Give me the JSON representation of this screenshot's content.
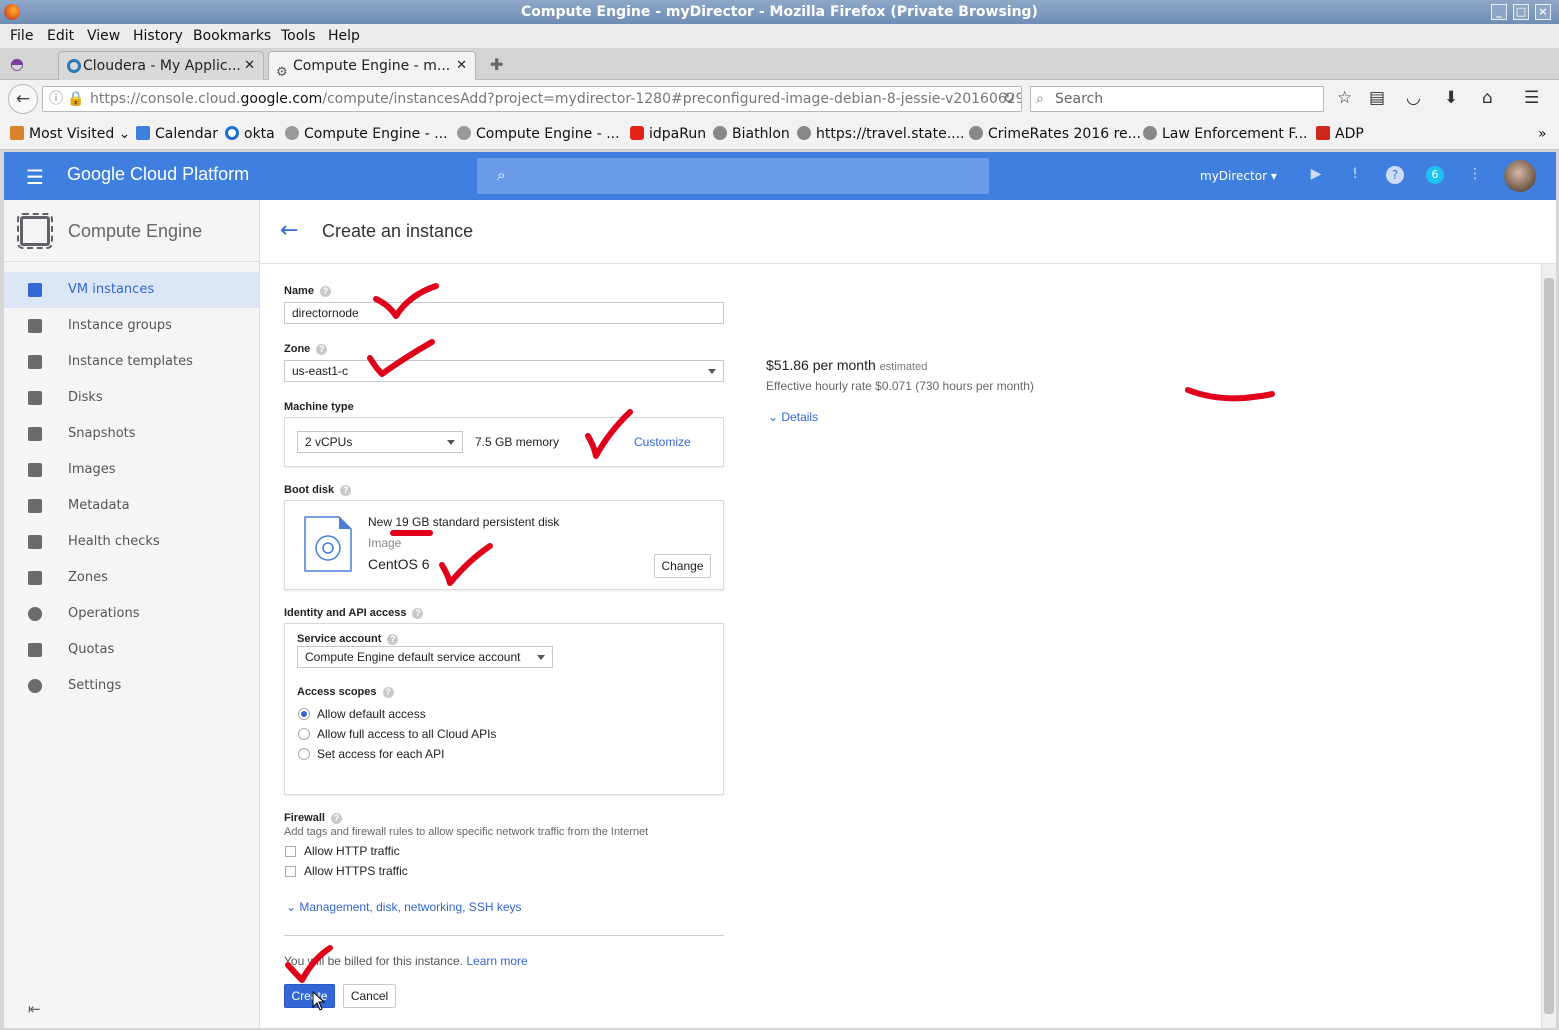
{
  "window": {
    "title": "Compute Engine - myDirector - Mozilla Firefox (Private Browsing)"
  },
  "menu": [
    "File",
    "Edit",
    "View",
    "History",
    "Bookmarks",
    "Tools",
    "Help"
  ],
  "tabs": [
    {
      "label": "Cloudera - My Applic...",
      "active": false
    },
    {
      "label": "Compute Engine - m...",
      "active": true
    }
  ],
  "url": {
    "prefix": "https://console.cloud.",
    "domain": "google.com",
    "path": "/compute/instancesAdd?project=mydirector-1280#preconfigured-image-debian-8-jessie-v20160629"
  },
  "search": {
    "placeholder": "Search"
  },
  "bookmarks": [
    "Most Visited",
    "Calendar",
    "okta",
    "Compute Engine - ...",
    "Compute Engine - ...",
    "idpaRun",
    "Biathlon",
    "https://travel.state....",
    "CrimeRates 2016 re...",
    "Law Enforcement F...",
    "ADP"
  ],
  "gcp": {
    "brand": "Google Cloud Platform",
    "project": "myDirector",
    "notifications": "6"
  },
  "sidebar": {
    "section": "Compute Engine",
    "items": [
      "VM instances",
      "Instance groups",
      "Instance templates",
      "Disks",
      "Snapshots",
      "Images",
      "Metadata",
      "Health checks",
      "Zones",
      "Operations",
      "Quotas",
      "Settings"
    ]
  },
  "page": {
    "title": "Create an instance"
  },
  "form": {
    "name_label": "Name",
    "name_value": "directornode",
    "zone_label": "Zone",
    "zone_value": "us-east1-c",
    "machine_label": "Machine type",
    "machine_value": "2 vCPUs",
    "memory": "7.5 GB memory",
    "customize": "Customize",
    "boot_label": "Boot disk",
    "boot_title": "New 19 GB standard persistent disk",
    "boot_image_label": "Image",
    "boot_image": "CentOS 6",
    "change": "Change",
    "identity_label": "Identity and API access",
    "service_label": "Service account",
    "service_value": "Compute Engine default service account",
    "scopes_label": "Access scopes",
    "scopes": [
      "Allow default access",
      "Allow full access to all Cloud APIs",
      "Set access for each API"
    ],
    "firewall_label": "Firewall",
    "firewall_desc": "Add tags and firewall rules to allow specific network traffic from the Internet",
    "firewall_opts": [
      "Allow HTTP traffic",
      "Allow HTTPS traffic"
    ],
    "advanced": "Management, disk, networking, SSH keys",
    "billing": "You will be billed for this instance.",
    "learn_more": "Learn more",
    "create": "Create",
    "cancel": "Cancel"
  },
  "pricing": {
    "monthly": "$51.86 per month",
    "estimated": "estimated",
    "hourly": "Effective hourly rate $0.071 (730 hours per month)",
    "details": "Details"
  },
  "colors": {
    "gcp_blue": "#3f7fe0",
    "accent": "#3367d6",
    "annotation": "#e0001a"
  }
}
